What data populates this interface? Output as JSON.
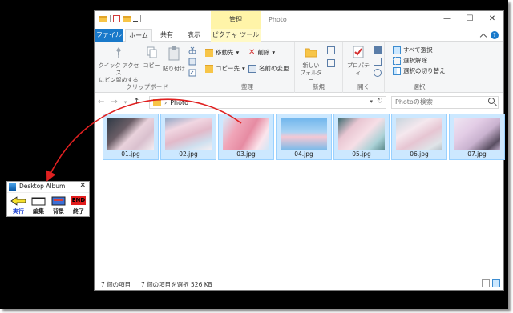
{
  "explorer": {
    "context_tab_title": "管理",
    "window_title": "Photo",
    "tabs": {
      "file": "ファイル",
      "home": "ホーム",
      "share": "共有",
      "view": "表示",
      "picture_tools": "ピクチャ ツール"
    },
    "ribbon": {
      "clipboard": {
        "label": "クリップボード",
        "quick_access": "クイック アクセス\nにピン留めする",
        "copy": "コピー",
        "paste": "貼り付け"
      },
      "organize": {
        "label": "整理",
        "move_to": "移動先",
        "copy_to": "コピー先",
        "delete": "削除",
        "rename": "名前の変更"
      },
      "new": {
        "label": "新規",
        "new_folder": "新しい\nフォルダー"
      },
      "open": {
        "label": "開く",
        "properties": "プロパティ"
      },
      "select": {
        "label": "選択",
        "select_all": "すべて選択",
        "select_none": "選択解除",
        "invert": "選択の切り替え"
      }
    },
    "address": {
      "path": "Photo"
    },
    "search": {
      "placeholder": "Photoの検索"
    },
    "files": [
      {
        "name": "01.jpg"
      },
      {
        "name": "02.jpg"
      },
      {
        "name": "03.jpg"
      },
      {
        "name": "04.jpg"
      },
      {
        "name": "05.jpg"
      },
      {
        "name": "06.jpg"
      },
      {
        "name": "07.jpg"
      }
    ],
    "status": {
      "count": "7 個の項目",
      "selected": "7 個の項目を選択 526 KB"
    }
  },
  "album": {
    "title": "Desktop Album",
    "buttons": {
      "run": "実行",
      "edit": "編集",
      "background": "背景",
      "exit": "終了",
      "exit_badge": "END"
    }
  },
  "colors": {
    "accent": "#1979ca",
    "selection": "#cce8ff",
    "context_tab": "#fff4a8",
    "arrow": "#e02020",
    "frame": "#000000"
  }
}
